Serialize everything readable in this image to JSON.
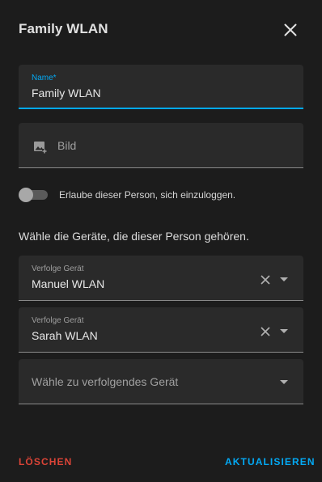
{
  "dialog": {
    "title": "Family WLAN"
  },
  "name_field": {
    "label": "Name*",
    "value": "Family WLAN"
  },
  "picture_field": {
    "label": "Bild"
  },
  "login_toggle": {
    "label": "Erlaube dieser Person, sich einzuloggen.",
    "enabled": false
  },
  "devices_section": {
    "text": "Wähle die Geräte, die dieser Person gehören.",
    "tracked_devices": [
      {
        "label": "Verfolge Gerät",
        "value": "Manuel WLAN"
      },
      {
        "label": "Verfolge Gerät",
        "value": "Sarah WLAN"
      }
    ],
    "new_device_placeholder": "Wähle zu verfolgendes Gerät"
  },
  "footer": {
    "delete_label": "LÖSCHEN",
    "update_label": "AKTUALISIEREN"
  },
  "colors": {
    "accent": "#03a9f4",
    "danger": "#db4437",
    "background": "#1c1c1c",
    "field": "#2a2a2a"
  },
  "icons": {
    "close": "close-icon",
    "image": "image-plus-icon",
    "clear": "clear-icon",
    "dropdown": "chevron-down-icon"
  }
}
